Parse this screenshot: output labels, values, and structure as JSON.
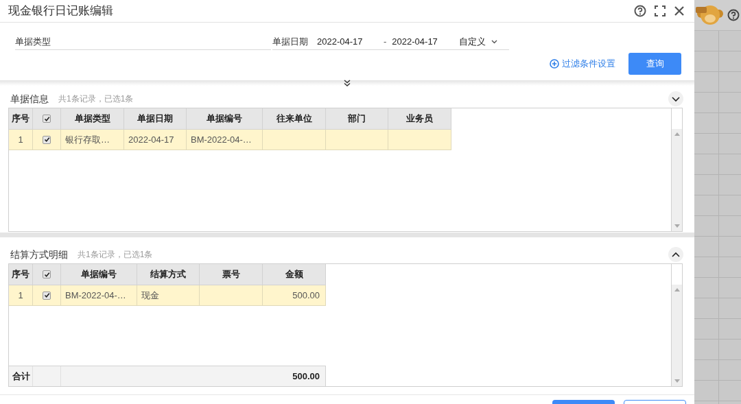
{
  "window": {
    "title": "现金银行日记账编辑"
  },
  "filter": {
    "doc_type": {
      "label": "单据类型"
    },
    "doc_date": {
      "label": "单据日期",
      "from": "2022-04-17",
      "separator": "-",
      "to": "2022-04-17",
      "range": "自定义"
    },
    "filter_link": "过滤条件设置",
    "query_button": "查询"
  },
  "sections": [
    {
      "title": "单据信息",
      "summary": "共1条记录，已选1条",
      "expanded": false,
      "all_checked": true,
      "columns": [
        {
          "label": "序号"
        },
        {},
        {
          "label": "单据类型"
        },
        {
          "label": "单据日期"
        },
        {
          "label": "单据编号"
        },
        {
          "label": "往来单位"
        },
        {
          "label": "部门"
        },
        {
          "label": "业务员"
        }
      ],
      "rows": [
        {
          "selected": true,
          "checked": true,
          "cells": [
            "1",
            "",
            "银行存取…",
            "2022-04-17",
            "BM-2022-04-…",
            "",
            "",
            ""
          ]
        }
      ]
    },
    {
      "title": "结算方式明细",
      "summary": "共1条记录，已选1条",
      "expanded": true,
      "all_checked": true,
      "columns": [
        {
          "label": "序号"
        },
        {},
        {
          "label": "单据编号"
        },
        {
          "label": "结算方式"
        },
        {
          "label": "票号"
        },
        {
          "label": "金额"
        }
      ],
      "rows": [
        {
          "selected": true,
          "checked": true,
          "cells": [
            "1",
            "",
            "BM-2022-04-…",
            "现金",
            "",
            "500.00"
          ]
        }
      ],
      "footer": {
        "label": "合计",
        "amount": "500.00"
      }
    }
  ]
}
